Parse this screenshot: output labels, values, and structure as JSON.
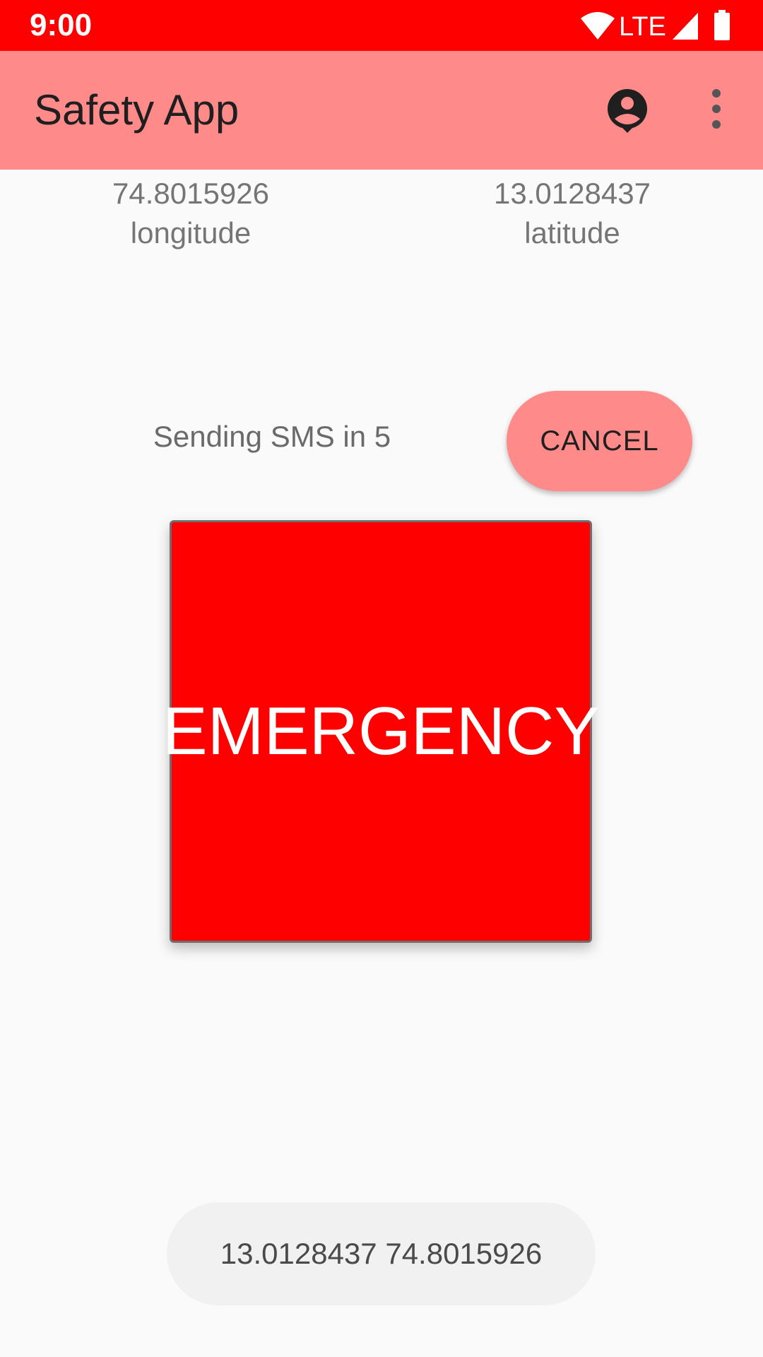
{
  "status_bar": {
    "time": "9:00",
    "network": "LTE",
    "icons": [
      "wifi-icon",
      "signal-icon",
      "battery-icon"
    ],
    "color": "#ff0000"
  },
  "app_bar": {
    "title": "Safety App",
    "color": "#ff8a8a",
    "actions": [
      "account-icon",
      "more-vert-icon"
    ]
  },
  "location": {
    "longitude_value": "74.8015926",
    "longitude_label": "longitude",
    "latitude_value": "13.0128437",
    "latitude_label": "latitude"
  },
  "sms": {
    "countdown_text": "Sending SMS in 5",
    "cancel_label": "CANCEL"
  },
  "emergency": {
    "label": "EMERGENCY",
    "color": "#ff0000"
  },
  "toast": {
    "text": "13.0128437 74.8015926"
  }
}
